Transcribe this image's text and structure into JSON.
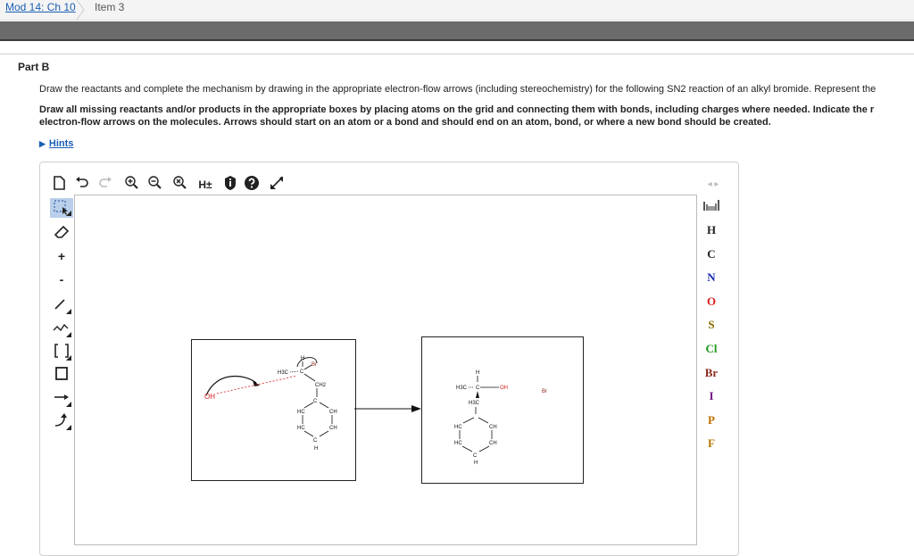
{
  "breadcrumb": {
    "module": "Mod 14: Ch 10",
    "item": "Item 3"
  },
  "part": {
    "title": "Part B"
  },
  "instructions": {
    "line1": "Draw the reactants and complete the mechanism by drawing in the appropriate electron-flow arrows (including stereochemistry) for the following SN2 reaction of an alkyl bromide. Represent the",
    "line2": "Draw all missing reactants and/or products in the appropriate boxes by placing atoms on the grid and connecting them with bonds, including charges where needed. Indicate the r electron-flow arrows on the molecules. Arrows should start on an atom or a bond and should end on an atom, bond, or where a new bond should be created."
  },
  "hints": {
    "label": "Hints"
  },
  "toolbar": {
    "h_label": "H±"
  },
  "left_tools": {
    "plus": "+",
    "minus": "-"
  },
  "elements": [
    {
      "symbol": "H",
      "color": "#222222"
    },
    {
      "symbol": "C",
      "color": "#222222"
    },
    {
      "symbol": "N",
      "color": "#1a2fb0"
    },
    {
      "symbol": "O",
      "color": "#d81e1e"
    },
    {
      "symbol": "S",
      "color": "#8a6a00"
    },
    {
      "symbol": "Cl",
      "color": "#1f9a1f"
    },
    {
      "symbol": "Br",
      "color": "#8a2a1a"
    },
    {
      "symbol": "I",
      "color": "#7a1a8a"
    },
    {
      "symbol": "P",
      "color": "#c07000"
    },
    {
      "symbol": "F",
      "color": "#b07a00"
    }
  ],
  "molecules": {
    "left": {
      "hydroxide": "OH",
      "h": "H",
      "methyl": "H3C",
      "c": "C",
      "br": "Br",
      "ch2": "CH2",
      "ch_top": "C",
      "hc1": "HC",
      "ch1": "CH",
      "hc2": "HC",
      "ch2b": "CH",
      "c_bottom": "C",
      "h_bottom": "H"
    },
    "right": {
      "h": "H",
      "methyl": "H3C",
      "c": "C",
      "oh": "OH",
      "br": "Br",
      "h3c": "H3C",
      "hc1": "HC",
      "ch1": "CH",
      "hc2": "HC",
      "ch2": "CH",
      "c_bottom": "C",
      "h_bottom": "H"
    }
  }
}
